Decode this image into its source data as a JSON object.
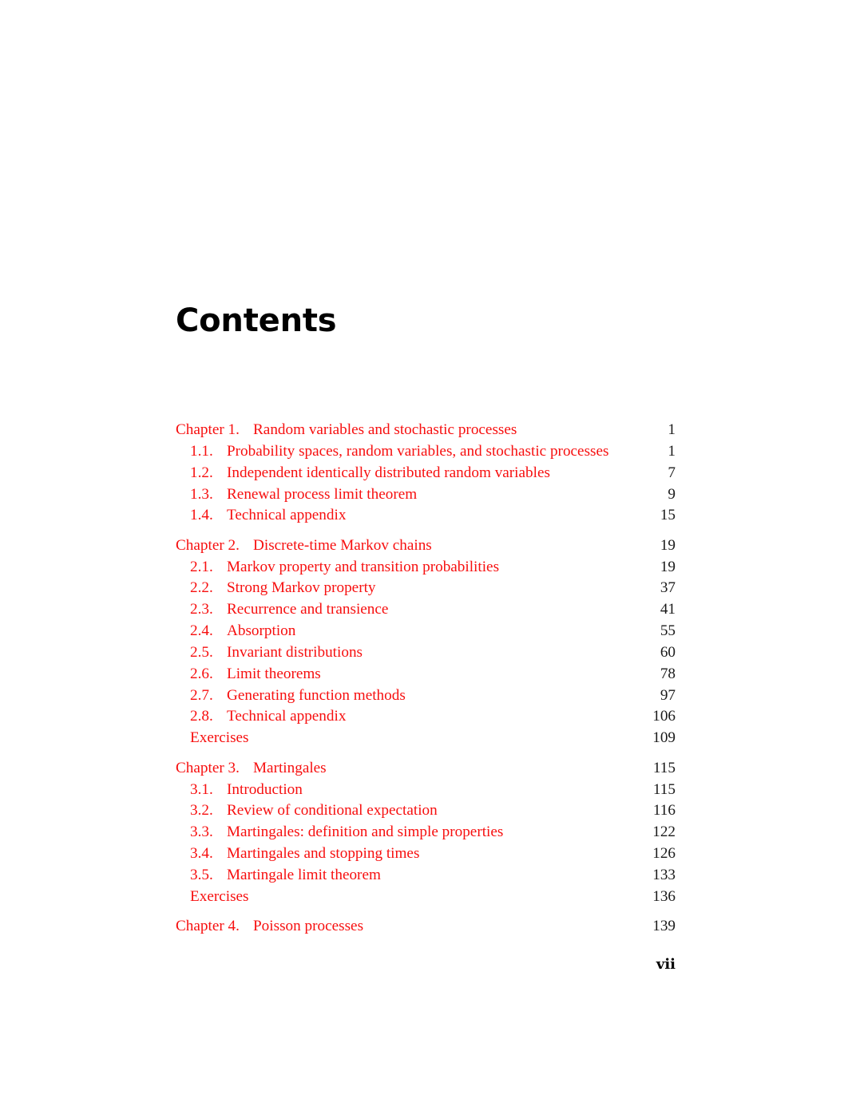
{
  "page": {
    "heading": "Contents",
    "folio": "vii",
    "accent_color": "#f70f0f",
    "page_number_color": "#1a1a1a"
  },
  "toc": {
    "entries": [
      {
        "kind": "chapter",
        "number": "Chapter 1.",
        "label": "Random variables and stochastic processes",
        "page": "1",
        "gap_before": false
      },
      {
        "kind": "section",
        "number": "1.1.",
        "label": "Probability spaces, random variables, and stochastic processes",
        "page": "1",
        "gap_before": false
      },
      {
        "kind": "section",
        "number": "1.2.",
        "label": "Independent identically distributed random variables",
        "page": "7",
        "gap_before": false
      },
      {
        "kind": "section",
        "number": "1.3.",
        "label": "Renewal process limit theorem",
        "page": "9",
        "gap_before": false
      },
      {
        "kind": "section",
        "number": "1.4.",
        "label": "Technical appendix",
        "page": "15",
        "gap_before": false
      },
      {
        "kind": "chapter",
        "number": "Chapter 2.",
        "label": "Discrete-time Markov chains",
        "page": "19",
        "gap_before": true
      },
      {
        "kind": "section",
        "number": "2.1.",
        "label": "Markov property and transition probabilities",
        "page": "19",
        "gap_before": false
      },
      {
        "kind": "section",
        "number": "2.2.",
        "label": "Strong Markov property",
        "page": "37",
        "gap_before": false
      },
      {
        "kind": "section",
        "number": "2.3.",
        "label": "Recurrence and transience",
        "page": "41",
        "gap_before": false
      },
      {
        "kind": "section",
        "number": "2.4.",
        "label": "Absorption",
        "page": "55",
        "gap_before": false
      },
      {
        "kind": "section",
        "number": "2.5.",
        "label": "Invariant distributions",
        "page": "60",
        "gap_before": false
      },
      {
        "kind": "section",
        "number": "2.6.",
        "label": "Limit theorems",
        "page": "78",
        "gap_before": false
      },
      {
        "kind": "section",
        "number": "2.7.",
        "label": "Generating function methods",
        "page": "97",
        "gap_before": false
      },
      {
        "kind": "section",
        "number": "2.8.",
        "label": "Technical appendix",
        "page": "106",
        "gap_before": false
      },
      {
        "kind": "plain",
        "number": "",
        "label": "Exercises",
        "page": "109",
        "gap_before": false
      },
      {
        "kind": "chapter",
        "number": "Chapter 3.",
        "label": "Martingales",
        "page": "115",
        "gap_before": true
      },
      {
        "kind": "section",
        "number": "3.1.",
        "label": "Introduction",
        "page": "115",
        "gap_before": false
      },
      {
        "kind": "section",
        "number": "3.2.",
        "label": "Review of conditional expectation",
        "page": "116",
        "gap_before": false
      },
      {
        "kind": "section",
        "number": "3.3.",
        "label": "Martingales: definition and simple properties",
        "page": "122",
        "gap_before": false
      },
      {
        "kind": "section",
        "number": "3.4.",
        "label": "Martingales and stopping times",
        "page": "126",
        "gap_before": false
      },
      {
        "kind": "section",
        "number": "3.5.",
        "label": "Martingale limit theorem",
        "page": "133",
        "gap_before": false
      },
      {
        "kind": "plain",
        "number": "",
        "label": "Exercises",
        "page": "136",
        "gap_before": false
      },
      {
        "kind": "chapter",
        "number": "Chapter 4.",
        "label": "Poisson processes",
        "page": "139",
        "gap_before": true
      }
    ]
  }
}
